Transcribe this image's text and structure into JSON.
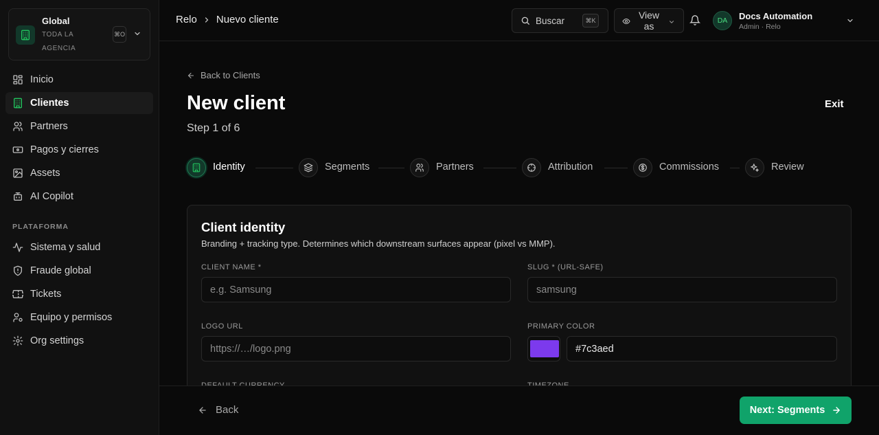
{
  "sidebar": {
    "org": {
      "name": "Global",
      "sub": "TODA LA AGENCIA",
      "kbd": "⌘O"
    },
    "nav_main": [
      {
        "label": "Inicio",
        "icon": "grid-icon",
        "active": false
      },
      {
        "label": "Clientes",
        "icon": "building-icon",
        "active": true
      },
      {
        "label": "Partners",
        "icon": "users-icon",
        "active": false
      },
      {
        "label": "Pagos y cierres",
        "icon": "banknote-icon",
        "active": false
      },
      {
        "label": "Assets",
        "icon": "image-icon",
        "active": false
      },
      {
        "label": "AI Copilot",
        "icon": "bot-icon",
        "active": false
      }
    ],
    "section_label": "PLATAFORMA",
    "nav_platform": [
      {
        "label": "Sistema y salud",
        "icon": "activity-icon"
      },
      {
        "label": "Fraude global",
        "icon": "shield-icon"
      },
      {
        "label": "Tickets",
        "icon": "ticket-icon"
      },
      {
        "label": "Equipo y permisos",
        "icon": "user-cog-icon"
      },
      {
        "label": "Org settings",
        "icon": "gear-icon"
      }
    ]
  },
  "topbar": {
    "breadcrumb": [
      "Relo",
      "Nuevo cliente"
    ],
    "search_label": "Buscar",
    "search_kbd": "⌘K",
    "view_as_label": "View as",
    "user": {
      "initials": "DA",
      "name": "Docs Automation",
      "role": "Admin · Relo"
    }
  },
  "main": {
    "back_label": "Back to Clients",
    "title": "New client",
    "step_text": "Step 1 of 6",
    "exit_label": "Exit",
    "steps": [
      {
        "label": "Identity",
        "icon": "building-icon",
        "active": true
      },
      {
        "label": "Segments",
        "icon": "layers-icon",
        "active": false
      },
      {
        "label": "Partners",
        "icon": "users-icon",
        "active": false
      },
      {
        "label": "Attribution",
        "icon": "crosshair-icon",
        "active": false
      },
      {
        "label": "Commissions",
        "icon": "dollar-icon",
        "active": false
      },
      {
        "label": "Review",
        "icon": "sparkles-icon",
        "active": false
      }
    ],
    "card": {
      "title": "Client identity",
      "description": "Branding + tracking type. Determines which downstream surfaces appear (pixel vs MMP).",
      "fields": {
        "client_name": {
          "label": "CLIENT NAME *",
          "placeholder": "e.g. Samsung",
          "value": ""
        },
        "slug": {
          "label": "SLUG * (URL-SAFE)",
          "placeholder": "samsung",
          "value": ""
        },
        "logo_url": {
          "label": "LOGO URL",
          "placeholder": "https://…/logo.png",
          "value": ""
        },
        "primary_color": {
          "label": "PRIMARY COLOR",
          "value": "#7c3aed",
          "swatch": "#7c3aed"
        },
        "default_currency": {
          "label": "DEFAULT CURRENCY"
        },
        "timezone": {
          "label": "TIMEZONE"
        }
      }
    }
  },
  "footer": {
    "back_label": "Back",
    "next_label": "Next: Segments"
  },
  "colors": {
    "accent": "#10a36a",
    "accent_dark": "#12382a",
    "background": "#0a0a0a",
    "sidebar": "#111111"
  }
}
